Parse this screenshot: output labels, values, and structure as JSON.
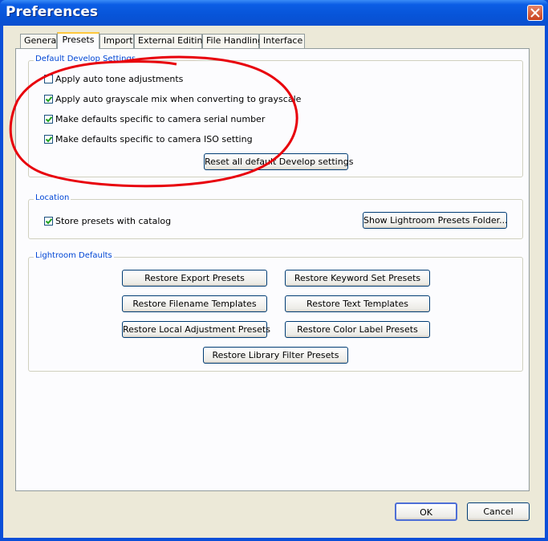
{
  "window": {
    "title": "Preferences"
  },
  "tabs": [
    {
      "label": "General",
      "active": false
    },
    {
      "label": "Presets",
      "active": true
    },
    {
      "label": "Import",
      "active": false
    },
    {
      "label": "External Editing",
      "active": false
    },
    {
      "label": "File Handling",
      "active": false
    },
    {
      "label": "Interface",
      "active": false
    }
  ],
  "develop": {
    "group_label": "Default Develop Settings",
    "options": [
      {
        "label": "Apply auto tone adjustments",
        "checked": false
      },
      {
        "label": "Apply auto grayscale mix when converting to grayscale",
        "checked": true
      },
      {
        "label": "Make defaults specific to camera serial number",
        "checked": true
      },
      {
        "label": "Make defaults specific to camera ISO setting",
        "checked": true
      }
    ],
    "reset_button": "Reset all default Develop settings"
  },
  "location": {
    "group_label": "Location",
    "store_presets": {
      "label": "Store presets with catalog",
      "checked": true
    },
    "show_folder_button": "Show Lightroom Presets Folder..."
  },
  "lightroom_defaults": {
    "group_label": "Lightroom Defaults",
    "restore_export": "Restore Export Presets",
    "restore_keyword": "Restore Keyword Set Presets",
    "restore_filename": "Restore Filename Templates",
    "restore_text": "Restore Text Templates",
    "restore_local": "Restore Local Adjustment Presets",
    "restore_color": "Restore Color Label Presets",
    "restore_library": "Restore Library Filter Presets"
  },
  "footer": {
    "ok": "OK",
    "cancel": "Cancel"
  },
  "colors": {
    "titlebar": "#0754d8",
    "dialog_bg": "#ece9d8",
    "group_label": "#0046d5",
    "annotation": "#e8000b"
  }
}
